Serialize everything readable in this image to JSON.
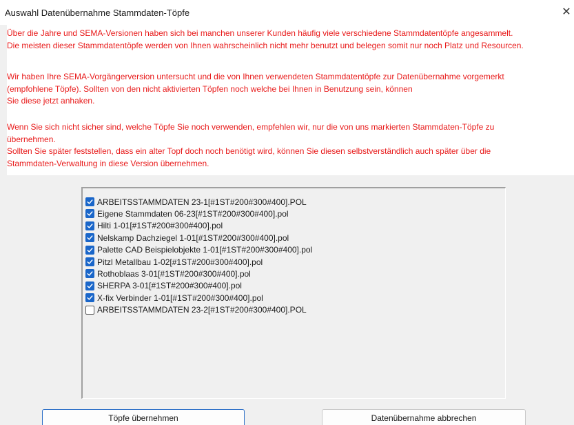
{
  "window": {
    "title": "Auswahl Datenübernahme Stammdaten-Töpfe",
    "close_glyph": "✕"
  },
  "info": {
    "paragraphs": [
      [
        "Über die Jahre und SEMA-Versionen haben sich bei manchen unserer Kunden häufig viele verschiedene Stammdatentöpfe angesammelt.",
        "Die meisten dieser Stammdatentöpfe werden von Ihnen wahrscheinlich nicht mehr benutzt und belegen somit nur noch Platz und Resourcen."
      ],
      [
        "Wir haben Ihre SEMA-Vorgängerversion untersucht und die von Ihnen verwendeten Stammdatentöpfe zur Datenübernahme vorgemerkt",
        "(empfohlene Töpfe). Sollten von den nicht aktivierten Töpfen noch welche bei Ihnen in Benutzung sein, können",
        "Sie diese jetzt anhaken."
      ],
      [
        "Wenn Sie sich nicht sicher sind, welche Töpfe Sie noch verwenden, empfehlen wir, nur die von uns markierten Stammdaten-Töpfe zu",
        "übernehmen.",
        "Sollten Sie später feststellen, dass ein alter Topf doch noch benötigt wird, können Sie diesen selbstverständlich auch später über die",
        "Stammdaten-Verwaltung in diese Version übernehmen."
      ]
    ],
    "text_color": "#e81a1a"
  },
  "list": {
    "items": [
      {
        "label": "ARBEITSSTAMMDATEN 23-1[#1ST#200#300#400].POL",
        "checked": true
      },
      {
        "label": "Eigene Stammdaten 06-23[#1ST#200#300#400].pol",
        "checked": true
      },
      {
        "label": "Hilti 1-01[#1ST#200#300#400].pol",
        "checked": true
      },
      {
        "label": "Nelskamp Dachziegel 1-01[#1ST#200#300#400].pol",
        "checked": true
      },
      {
        "label": "Palette CAD Beispielobjekte 1-01[#1ST#200#300#400].pol",
        "checked": true
      },
      {
        "label": "Pitzl Metallbau 1-02[#1ST#200#300#400].pol",
        "checked": true
      },
      {
        "label": "Rothoblaas 3-01[#1ST#200#300#400].pol",
        "checked": true
      },
      {
        "label": "SHERPA 3-01[#1ST#200#300#400].pol",
        "checked": true
      },
      {
        "label": "X-fix Verbinder 1-01[#1ST#200#300#400].pol",
        "checked": true
      },
      {
        "label": "ARBEITSSTAMMDATEN 23-2[#1ST#200#300#400].POL",
        "checked": false
      }
    ],
    "accent_color": "#1a66c9"
  },
  "buttons": {
    "accept_label": "Töpfe übernehmen",
    "cancel_label": "Datenübernahme abbrechen"
  }
}
